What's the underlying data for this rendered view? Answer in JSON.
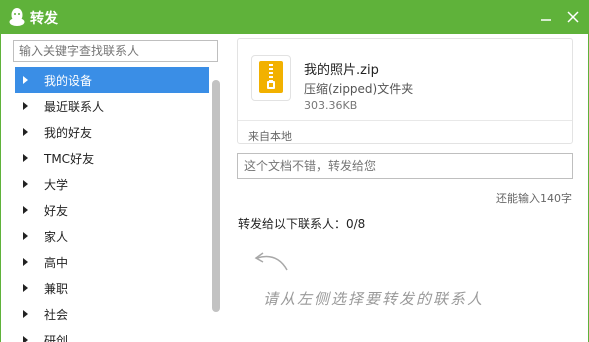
{
  "window": {
    "title": "转发",
    "accent": "#5fb23a",
    "selection_color": "#3a8ee6"
  },
  "search": {
    "placeholder": "输入关键字查找联系人"
  },
  "contacts": [
    {
      "label": "我的设备",
      "selected": true
    },
    {
      "label": "最近联系人",
      "selected": false
    },
    {
      "label": "我的好友",
      "selected": false
    },
    {
      "label": "TMC好友",
      "selected": false
    },
    {
      "label": "大学",
      "selected": false
    },
    {
      "label": "好友",
      "selected": false
    },
    {
      "label": "家人",
      "selected": false
    },
    {
      "label": "高中",
      "selected": false
    },
    {
      "label": "兼职",
      "selected": false
    },
    {
      "label": "社会",
      "selected": false
    },
    {
      "label": "研创",
      "selected": false
    }
  ],
  "file": {
    "name": "我的照片.zip",
    "type": "压缩(zipped)文件夹",
    "size": "303.36KB",
    "source": "来自本地",
    "icon": "zip-folder-icon"
  },
  "message": {
    "placeholder": "这个文档不错，转发给您"
  },
  "char_limit": "还能输入140字",
  "recipients_label": "转发给以下联系人：0/8",
  "hint": "请从左侧选择要转发的联系人"
}
